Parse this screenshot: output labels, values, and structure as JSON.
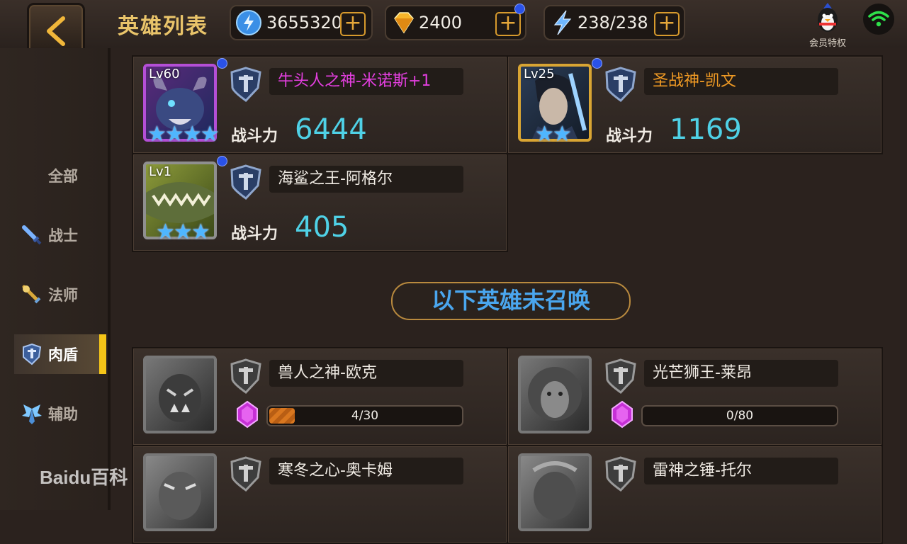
{
  "header": {
    "title": "英雄列表",
    "resources": [
      {
        "name": "energy",
        "icon": "blue-orb-icon",
        "value": "3655320"
      },
      {
        "name": "gems",
        "icon": "diamond-icon",
        "value": "2400"
      },
      {
        "name": "stamina",
        "icon": "lightning-icon",
        "value": "238/238"
      }
    ],
    "vip_label": "会员特权"
  },
  "sidebar": {
    "items": [
      {
        "label": "全部",
        "icon": ""
      },
      {
        "label": "战士",
        "icon": "sword-icon"
      },
      {
        "label": "法师",
        "icon": "staff-icon"
      },
      {
        "label": "肉盾",
        "icon": "shield-icon"
      },
      {
        "label": "辅助",
        "icon": "wings-icon"
      }
    ],
    "active": "肉盾"
  },
  "owned_heroes": [
    {
      "level": "Lv60",
      "name": "牛头人之神-米诺斯+1",
      "name_color": "#e43fe0",
      "power_label": "战斗力",
      "power": "6444",
      "stars": 4
    },
    {
      "level": "Lv25",
      "name": "圣战神-凯文",
      "name_color": "#f09a24",
      "power_label": "战斗力",
      "power": "1169",
      "stars": 2
    },
    {
      "level": "Lv1",
      "name": "海鲨之王-阿格尔",
      "name_color": "#f0ebe4",
      "power_label": "战斗力",
      "power": "405",
      "stars": 3
    }
  ],
  "divider_label": "以下英雄未召唤",
  "unsummoned_heroes": [
    {
      "name": "兽人之神-欧克",
      "progress_text": "4/30",
      "progress": 0.133
    },
    {
      "name": "光芒狮王-莱昂",
      "progress_text": "0/80",
      "progress": 0
    },
    {
      "name": "寒冬之心-奥卡姆",
      "progress_text": "",
      "progress": 0
    },
    {
      "name": "雷神之锤-托尔",
      "progress_text": "",
      "progress": 0
    }
  ],
  "watermark": "Baidu百科",
  "colors": {
    "accent_gold": "#e9c46a",
    "power_cyan": "#4fd1e6",
    "active_indicator": "#f5c518",
    "divider_text": "#4aa6ee"
  }
}
